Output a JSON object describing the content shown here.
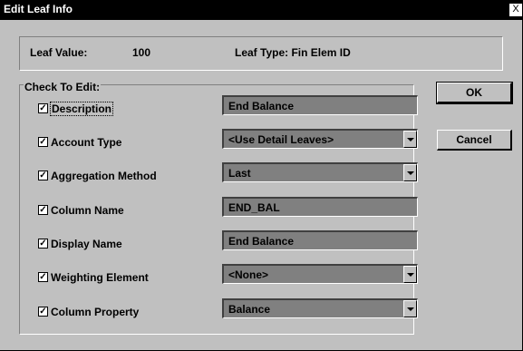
{
  "window": {
    "title": "Edit Leaf Info",
    "close_glyph": "X"
  },
  "info": {
    "leaf_value_label": "Leaf Value:",
    "leaf_value": "100",
    "leaf_type_label": "Leaf Type: Fin Elem ID"
  },
  "group": {
    "label": "Check To Edit:"
  },
  "rows": [
    {
      "label": "Description",
      "checked": true,
      "value": "End Balance",
      "kind": "text"
    },
    {
      "label": "Account Type",
      "checked": true,
      "value": "<Use Detail Leaves>",
      "kind": "dropdown"
    },
    {
      "label": "Aggregation Method",
      "checked": true,
      "value": "Last",
      "kind": "dropdown"
    },
    {
      "label": "Column Name",
      "checked": true,
      "value": "END_BAL",
      "kind": "text"
    },
    {
      "label": "Display Name",
      "checked": true,
      "value": "End Balance",
      "kind": "text"
    },
    {
      "label": "Weighting Element",
      "checked": true,
      "value": "<None>",
      "kind": "dropdown"
    },
    {
      "label": "Column Property",
      "checked": true,
      "value": "Balance",
      "kind": "dropdown"
    }
  ],
  "buttons": {
    "ok_label": "OK",
    "cancel_label": "Cancel"
  },
  "check_glyph": "✓"
}
